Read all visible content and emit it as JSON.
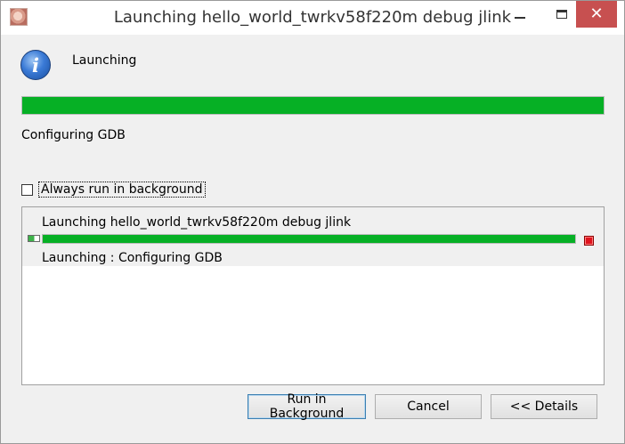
{
  "window": {
    "title": "Launching hello_world_twrkv58f220m debug jlink",
    "close_glyph": "✕"
  },
  "dialog": {
    "heading": "Launching",
    "info_glyph": "i",
    "progress_percent": 100,
    "status": "Configuring GDB",
    "always_background_label": "Always run in background",
    "always_background_checked": false
  },
  "jobs": [
    {
      "title": "Launching hello_world_twrkv58f220m debug jlink",
      "progress_percent": 100,
      "status": "Launching : Configuring GDB"
    }
  ],
  "buttons": {
    "run_background": "Run in Background",
    "cancel": "Cancel",
    "details": "<< Details"
  },
  "colors": {
    "progress": "#06b025",
    "stop": "#e0141e",
    "close_button": "#c75050"
  }
}
